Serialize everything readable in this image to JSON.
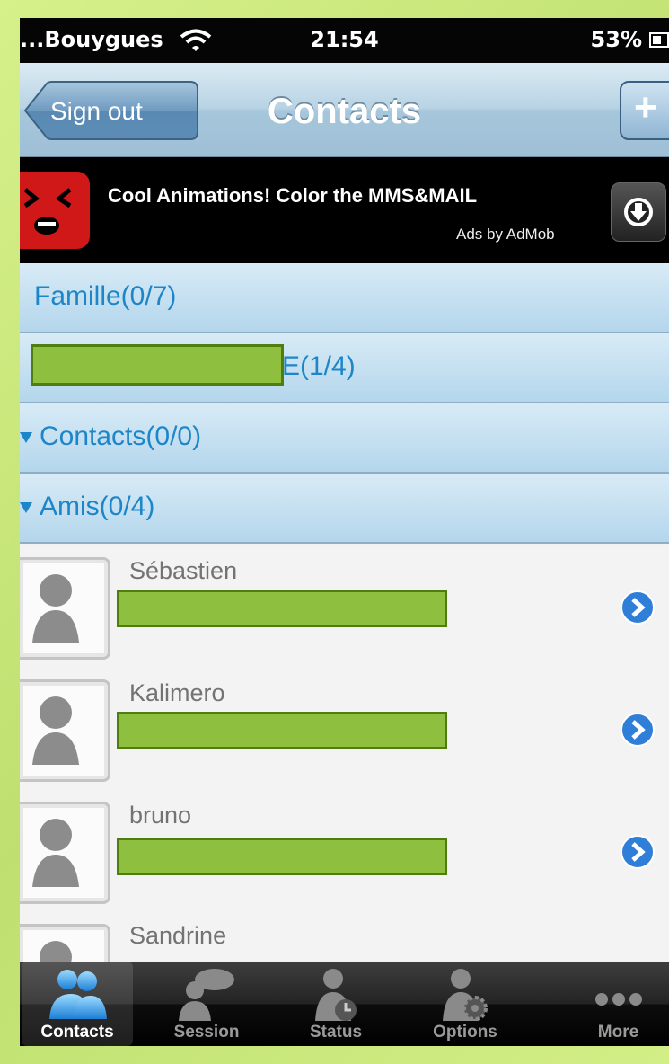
{
  "status_bar": {
    "carrier": "...Bouygues",
    "time": "21:54",
    "battery_percent": "53%"
  },
  "nav_bar": {
    "back_label": "Sign out",
    "title": "Contacts",
    "add_label": "+"
  },
  "ad": {
    "headline": "Cool Animations! Color the MMS&MAIL",
    "credit": "Ads by AdMob"
  },
  "groups": [
    {
      "label": "Famille(0/7)",
      "expanded": false
    },
    {
      "label": "E(1/4)",
      "expanded": false,
      "redacted_prefix": true
    },
    {
      "label": "Contacts(0/0)",
      "expanded": true
    },
    {
      "label": "Amis(0/4)",
      "expanded": true
    }
  ],
  "contacts": [
    {
      "name": "Sébastien"
    },
    {
      "name": "Kalimero"
    },
    {
      "name": "bruno"
    },
    {
      "name": "Sandrine"
    }
  ],
  "tab_bar": {
    "selected": "Contacts",
    "tabs": [
      {
        "label": "Contacts",
        "icon": "contacts-icon"
      },
      {
        "label": "Session",
        "icon": "session-icon"
      },
      {
        "label": "Status",
        "icon": "status-icon"
      },
      {
        "label": "Options",
        "icon": "options-icon"
      },
      {
        "label": "More",
        "icon": "more-icon"
      }
    ]
  },
  "colors": {
    "group_text": "#1c86c8",
    "redaction": "#8fbf3e",
    "ad_background": "#000000",
    "tab_bar": "#111111"
  }
}
